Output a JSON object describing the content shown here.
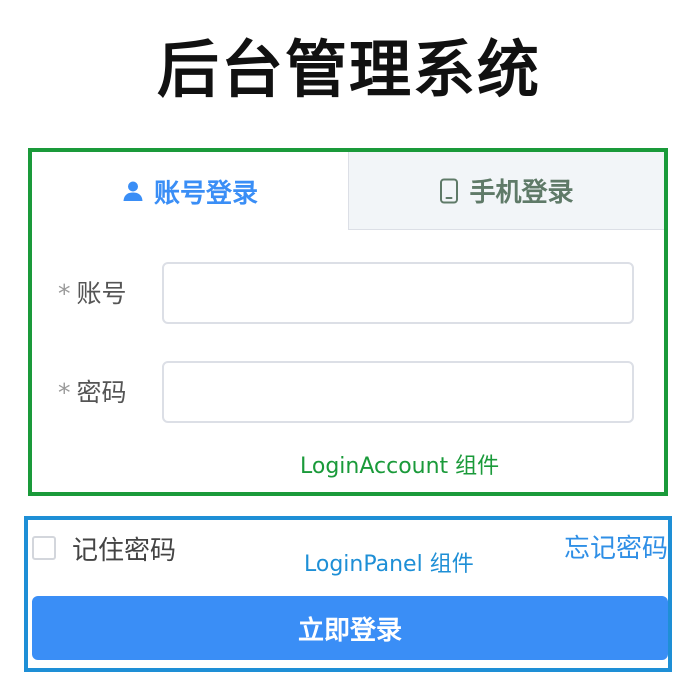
{
  "page_title": "后台管理系统",
  "login_account": {
    "tabs": {
      "account_label": "账号登录",
      "phone_label": "手机登录"
    },
    "fields": {
      "account_label": "账号",
      "account_value": "",
      "password_label": "密码",
      "password_value": ""
    },
    "required_mark": "*",
    "caption": "LoginAccount 组件"
  },
  "login_panel": {
    "remember_label": "记住密码",
    "remember_checked": false,
    "forgot_label": "忘记密码",
    "caption": "LoginPanel 组件",
    "submit_label": "立即登录"
  },
  "colors": {
    "accent": "#3a8ef6",
    "account_box_border": "#1a9a3a",
    "panel_box_border": "#1e8fd6"
  },
  "icons": {
    "account_tab": "user-icon",
    "phone_tab": "mobile-phone-icon"
  }
}
